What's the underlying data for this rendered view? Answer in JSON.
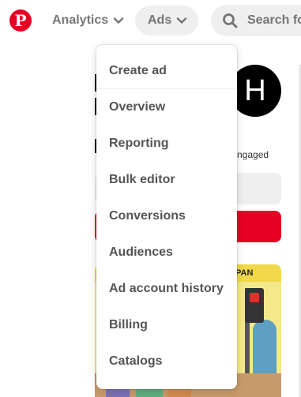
{
  "header": {
    "logo_letter": "P",
    "nav": {
      "analytics_label": "Analytics",
      "ads_label": "Ads"
    },
    "search": {
      "placeholder": "Search fo"
    }
  },
  "background": {
    "avatar_letter": "H",
    "engaged_text": "ngaged",
    "art_caption": "PAN"
  },
  "ads_menu": {
    "items": [
      {
        "label": "Create ad"
      },
      {
        "label": "Overview"
      },
      {
        "label": "Reporting"
      },
      {
        "label": "Bulk editor"
      },
      {
        "label": "Conversions"
      },
      {
        "label": "Audiences"
      },
      {
        "label": "Ad account history"
      },
      {
        "label": "Billing"
      },
      {
        "label": "Catalogs"
      }
    ]
  },
  "colors": {
    "brand_red": "#e60023",
    "nav_gray": "#767676",
    "pill_bg": "#efefef",
    "menu_text": "#555555"
  },
  "icons": {
    "logo": "pinterest-logo-icon",
    "chevron": "chevron-down-icon",
    "search": "search-icon"
  }
}
